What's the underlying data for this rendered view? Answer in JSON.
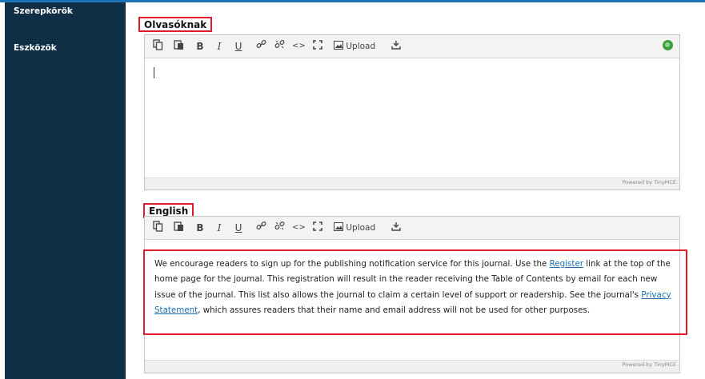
{
  "sidebar": {
    "items": [
      {
        "label": "Szerepkörök"
      },
      {
        "label": "Eszközök"
      }
    ]
  },
  "editors": [
    {
      "language": "Olvasóknak",
      "content": "",
      "powered": "Powered by TinyMCE"
    },
    {
      "language": "English",
      "content_parts": [
        "We encourage readers to sign up for the publishing notification service for this journal. Use the ",
        "Register",
        " link at the top of the home page for the journal. This registration will result in the reader receiving the Table of Contents by email for each new issue of the journal. This list also allows the journal to claim a certain level of support or readership. See the journal's ",
        "Privacy Statement",
        ", which assures readers that their name and email address will not be used for other purposes."
      ],
      "powered": "Powered by TinyMCE"
    }
  ],
  "toolbar": {
    "copy_icon": "copy-icon",
    "paste_icon": "paste-icon",
    "bold": "B",
    "italic": "I",
    "underline": "U",
    "link_icon": "link-icon",
    "unlink_icon": "unlink-icon",
    "code": "<>",
    "fullscreen_icon": "fullscreen-icon",
    "upload_label": "Upload",
    "download_icon": "download-icon"
  },
  "colors": {
    "sidebar": "#0e2f45",
    "highlight": "#e01b2b",
    "link": "#1a6fb0",
    "status_dot": "#3aa13a"
  }
}
